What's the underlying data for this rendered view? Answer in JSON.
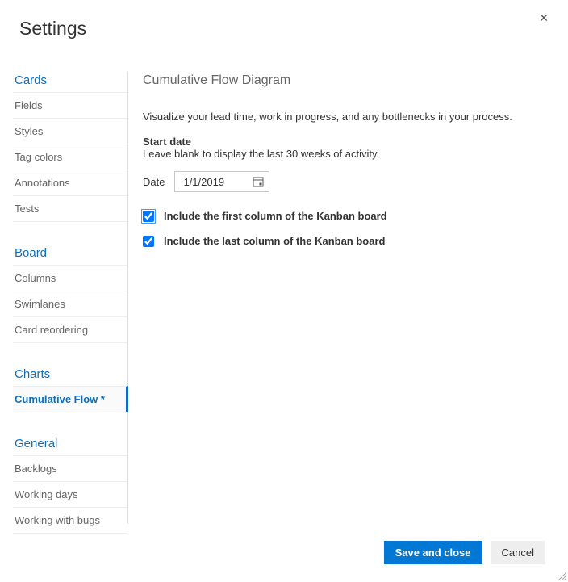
{
  "dialog": {
    "title": "Settings"
  },
  "sidebar": {
    "groups": [
      {
        "header": "Cards",
        "items": [
          "Fields",
          "Styles",
          "Tag colors",
          "Annotations",
          "Tests"
        ]
      },
      {
        "header": "Board",
        "items": [
          "Columns",
          "Swimlanes",
          "Card reordering"
        ]
      },
      {
        "header": "Charts",
        "items": [
          "Cumulative Flow *"
        ],
        "activeIndex": 0
      },
      {
        "header": "General",
        "items": [
          "Backlogs",
          "Working days",
          "Working with bugs"
        ]
      }
    ]
  },
  "panel": {
    "title": "Cumulative Flow Diagram",
    "description": "Visualize your lead time, work in progress, and any bottlenecks in your process.",
    "startDate": {
      "label": "Start date",
      "hint": "Leave blank to display the last 30 weeks of activity.",
      "dateLabel": "Date",
      "value": "1/1/2019"
    },
    "options": {
      "includeFirst": {
        "label": "Include the first column of the Kanban board",
        "checked": true
      },
      "includeLast": {
        "label": "Include the last column of the Kanban board",
        "checked": true
      }
    }
  },
  "footer": {
    "primary": "Save and close",
    "secondary": "Cancel"
  }
}
